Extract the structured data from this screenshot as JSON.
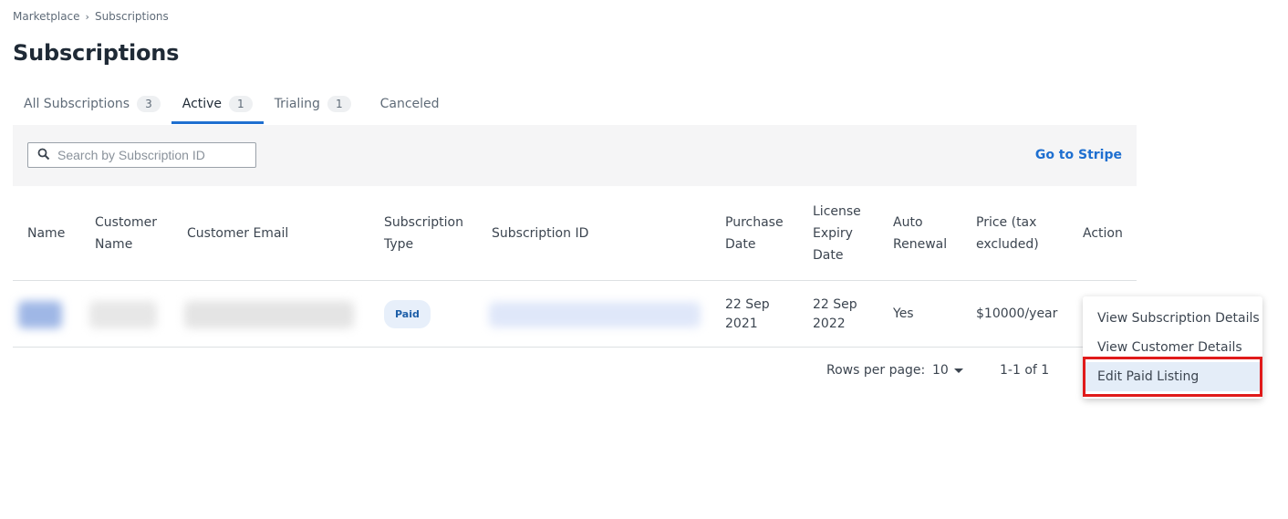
{
  "breadcrumb": {
    "root": "Marketplace",
    "current": "Subscriptions"
  },
  "page": {
    "title": "Subscriptions"
  },
  "tabs": [
    {
      "label": "All Subscriptions",
      "count": "3"
    },
    {
      "label": "Active",
      "count": "1"
    },
    {
      "label": "Trialing",
      "count": "1"
    },
    {
      "label": "Canceled"
    }
  ],
  "toolbar": {
    "search_placeholder": "Search by Subscription ID",
    "stripe_link": "Go to Stripe"
  },
  "table": {
    "headers": {
      "name": "Name",
      "customer_name": "Customer Name",
      "customer_email": "Customer Email",
      "subscription_type": "Subscription Type",
      "subscription_id": "Subscription ID",
      "purchase_date": "Purchase Date",
      "license_expiry": "License Expiry Date",
      "auto_renewal": "Auto Renewal",
      "price": "Price (tax excluded)",
      "action": "Action"
    },
    "rows": [
      {
        "type": "Paid",
        "purchase_date": "22 Sep 2021",
        "license_expiry": "22 Sep 2022",
        "auto_renewal": "Yes",
        "price": "$10000/year"
      }
    ]
  },
  "pagination": {
    "rows_per_page_label": "Rows per page:",
    "rows_per_page": "10",
    "range": "1-1 of 1"
  },
  "action_menu": {
    "items": [
      "View Subscription Details",
      "View Customer Details",
      "Edit Paid Listing"
    ]
  },
  "colors": {
    "accent": "#1e6fd0",
    "highlight_border": "#e01a1a"
  },
  "icons": {
    "search": "search-icon",
    "dropdown": "caret-down-icon"
  }
}
